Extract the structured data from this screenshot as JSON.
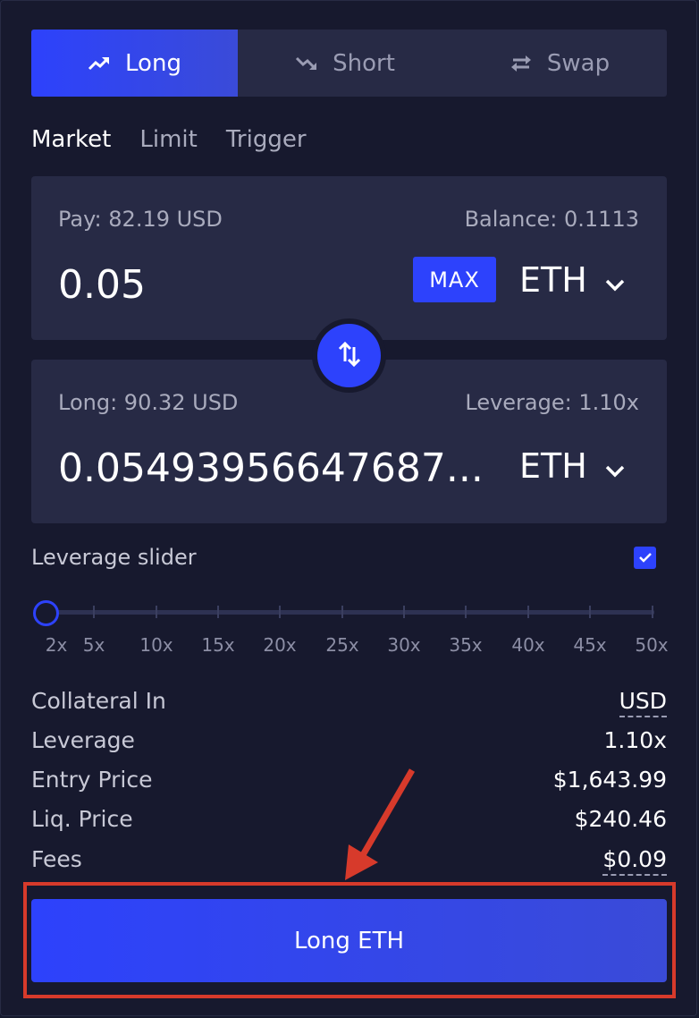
{
  "tabs": [
    {
      "label": "Long",
      "icon": "trend-up-icon"
    },
    {
      "label": "Short",
      "icon": "trend-down-icon"
    },
    {
      "label": "Swap",
      "icon": "swap-arrows-icon"
    }
  ],
  "order_types": [
    "Market",
    "Limit",
    "Trigger"
  ],
  "pay": {
    "label": "Pay: 82.19 USD",
    "balance": "Balance: 0.1113",
    "value": "0.05",
    "max_label": "MAX",
    "token": "ETH"
  },
  "long": {
    "label": "Long: 90.32 USD",
    "leverage": "Leverage: 1.10x",
    "value": "0.05493956647687...",
    "token": "ETH"
  },
  "leverage_slider": {
    "label": "Leverage slider",
    "checked": true,
    "current": 1.1,
    "marks": [
      "2x",
      "5x",
      "10x",
      "15x",
      "20x",
      "25x",
      "30x",
      "35x",
      "40x",
      "45x",
      "50x"
    ]
  },
  "info": {
    "collateral_label": "Collateral In",
    "collateral_value": "USD",
    "leverage_label": "Leverage",
    "leverage_value": "1.10x",
    "entry_label": "Entry Price",
    "entry_value": "$1,643.99",
    "liq_label": "Liq. Price",
    "liq_value": "$240.46",
    "fees_label": "Fees",
    "fees_value": "$0.09"
  },
  "action_button": "Long ETH",
  "colors": {
    "accent": "#2d42fc",
    "background": "#17192e",
    "box": "#272a45",
    "annotation": "#d73a2b"
  }
}
